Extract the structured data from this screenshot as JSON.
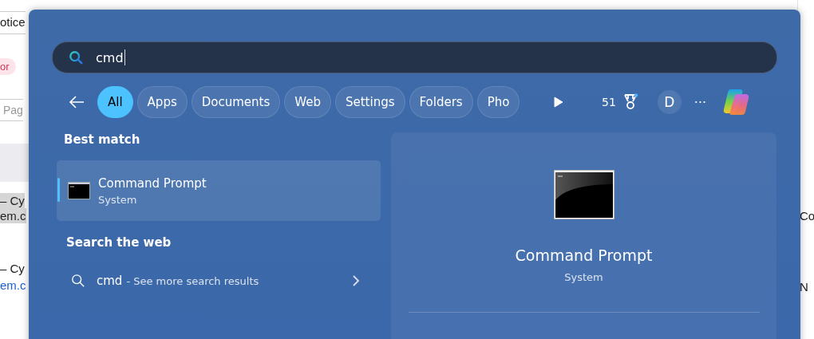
{
  "background_page": {
    "left_fragments": [
      {
        "kind": "text",
        "text": "otice"
      },
      {
        "kind": "badge",
        "text": "or"
      },
      {
        "kind": "input",
        "text": "Pag"
      },
      {
        "kind": "band"
      },
      {
        "kind": "highlight",
        "text": "– Cy"
      },
      {
        "kind": "highlight",
        "text": "em.c"
      },
      {
        "kind": "text",
        "text": "– Cy"
      },
      {
        "kind": "link",
        "text": "em.c"
      }
    ],
    "right_fragments": [
      "Co",
      "N"
    ]
  },
  "search": {
    "value": "cmd"
  },
  "filters": [
    {
      "label": "All",
      "selected": true
    },
    {
      "label": "Apps",
      "selected": false
    },
    {
      "label": "Documents",
      "selected": false
    },
    {
      "label": "Web",
      "selected": false
    },
    {
      "label": "Settings",
      "selected": false
    },
    {
      "label": "Folders",
      "selected": false
    },
    {
      "label": "Pho",
      "selected": false
    }
  ],
  "toolbar": {
    "points": "51",
    "avatar": "D",
    "more": "···"
  },
  "best_match": {
    "heading": "Best match",
    "item": {
      "title": "Command Prompt",
      "subtitle": "System",
      "selected": true
    }
  },
  "web": {
    "heading": "Search the web",
    "query": "cmd",
    "suffix": "- See more search results"
  },
  "preview": {
    "title": "Command Prompt",
    "subtitle": "System"
  }
}
